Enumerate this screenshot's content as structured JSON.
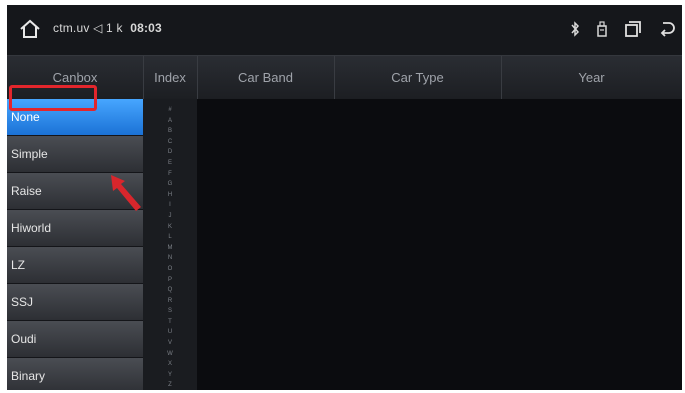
{
  "statusbar": {
    "info_text": "ctm.uv ◁ 1 k",
    "clock": "08:03",
    "icons": [
      "home-icon",
      "bluetooth-icon",
      "usb-icon",
      "recent-apps-icon",
      "back-icon"
    ]
  },
  "header": {
    "canbox": "Canbox",
    "index": "Index",
    "car_brand": "Car Band",
    "car_type": "Car Type",
    "year": "Year"
  },
  "canbox_list": {
    "selected_index": 0,
    "items": [
      {
        "label": "None"
      },
      {
        "label": "Simple"
      },
      {
        "label": "Raise"
      },
      {
        "label": "Hiworld"
      },
      {
        "label": "LZ"
      },
      {
        "label": "SSJ"
      },
      {
        "label": "Oudi"
      },
      {
        "label": "Binary"
      }
    ]
  },
  "index_letters": [
    "#",
    "A",
    "B",
    "C",
    "D",
    "E",
    "F",
    "G",
    "H",
    "I",
    "J",
    "K",
    "L",
    "M",
    "N",
    "O",
    "P",
    "Q",
    "R",
    "S",
    "T",
    "U",
    "V",
    "W",
    "X",
    "Y",
    "Z"
  ],
  "colors": {
    "selected": "#1b72d6",
    "highlight": "#e3262c"
  }
}
